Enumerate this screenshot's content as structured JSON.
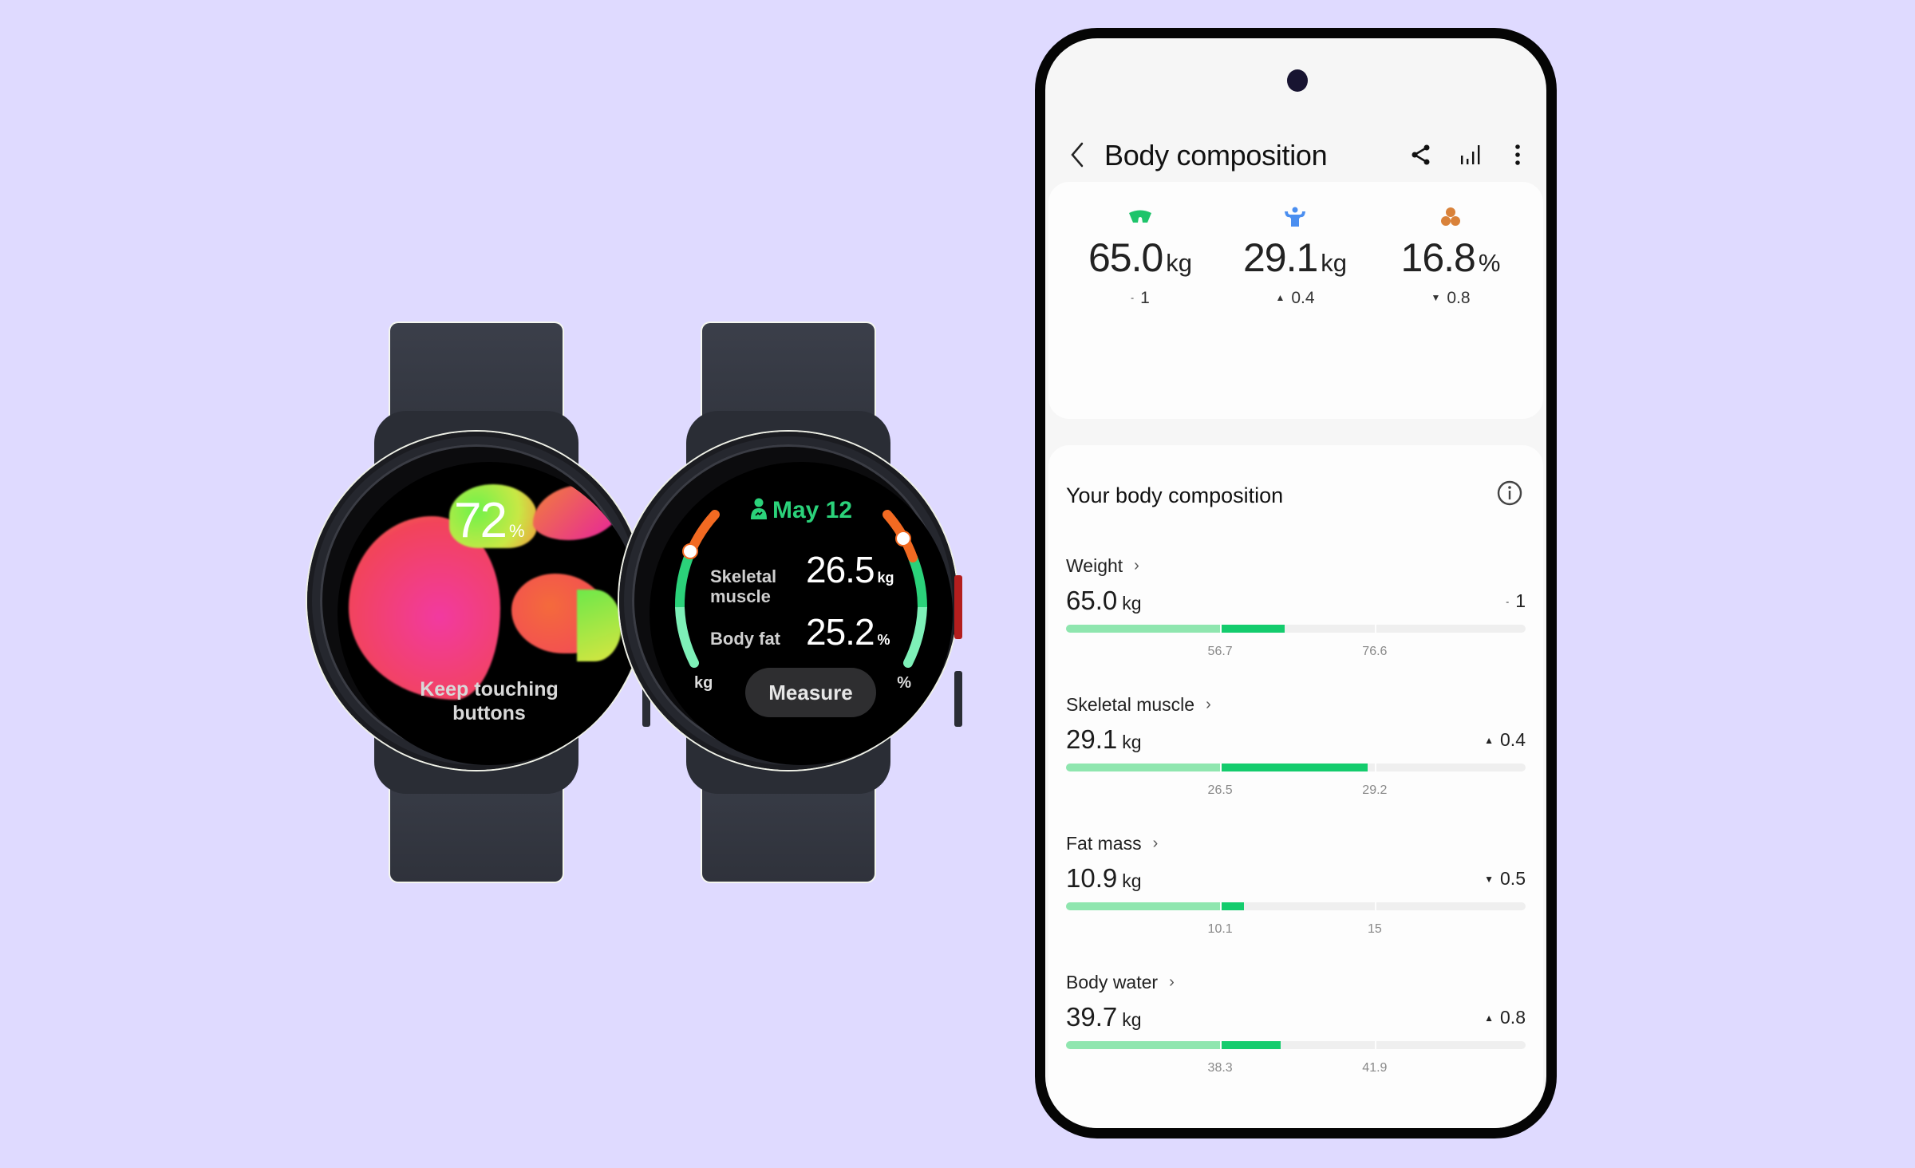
{
  "watch_left": {
    "progress_value": "72",
    "progress_unit": "%",
    "hint_line1": "Keep touching",
    "hint_line2": "buttons"
  },
  "watch_right": {
    "date": "May 12",
    "skeletal_muscle_label_line1": "Skeletal",
    "skeletal_muscle_label_line2": "muscle",
    "skeletal_muscle_value": "26.5",
    "skeletal_muscle_unit": "kg",
    "body_fat_label": "Body fat",
    "body_fat_value": "25.2",
    "body_fat_unit": "%",
    "left_arc_unit": "kg",
    "right_arc_unit": "%",
    "measure_label": "Measure",
    "colors": {
      "accent": "#2bd27a",
      "high": "#f26a22",
      "normal": "#2bd27a",
      "low": "#7ef0b8"
    }
  },
  "phone": {
    "title": "Body composition",
    "icons": [
      "back-icon",
      "share-icon",
      "trend-icon",
      "more-icon"
    ],
    "summary": [
      {
        "icon": "weight-scale-icon",
        "icon_color": "#1ec46a",
        "value": "65.0",
        "unit": "kg",
        "delta_symbol": "-",
        "delta": "1"
      },
      {
        "icon": "muscle-icon",
        "icon_color": "#4a8ef0",
        "value": "29.1",
        "unit": "kg",
        "delta_symbol": "▲",
        "delta": "0.4"
      },
      {
        "icon": "body-fat-icon",
        "icon_color": "#d9823a",
        "value": "16.8",
        "unit": "%",
        "delta_symbol": "▼",
        "delta": "0.8"
      }
    ],
    "detail": {
      "title": "Your body composition",
      "items": [
        {
          "label": "Weight",
          "value": "65.0",
          "unit": "kg",
          "delta_symbol": "-",
          "delta": "1",
          "range_low": "56.7",
          "range_high": "76.6",
          "low_frac": 0.333,
          "fill_frac": 0.473
        },
        {
          "label": "Skeletal muscle",
          "value": "29.1",
          "unit": "kg",
          "delta_symbol": "▲",
          "delta": "0.4",
          "range_low": "26.5",
          "range_high": "29.2",
          "low_frac": 0.333,
          "fill_frac": 0.651
        },
        {
          "label": "Fat mass",
          "value": "10.9",
          "unit": "kg",
          "delta_symbol": "▼",
          "delta": "0.5",
          "range_low": "10.1",
          "range_high": "15",
          "low_frac": 0.333,
          "fill_frac": 0.385
        },
        {
          "label": "Body water",
          "value": "39.7",
          "unit": "kg",
          "delta_symbol": "▲",
          "delta": "0.8",
          "range_low": "38.3",
          "range_high": "41.9",
          "low_frac": 0.333,
          "fill_frac": 0.463
        }
      ]
    }
  }
}
